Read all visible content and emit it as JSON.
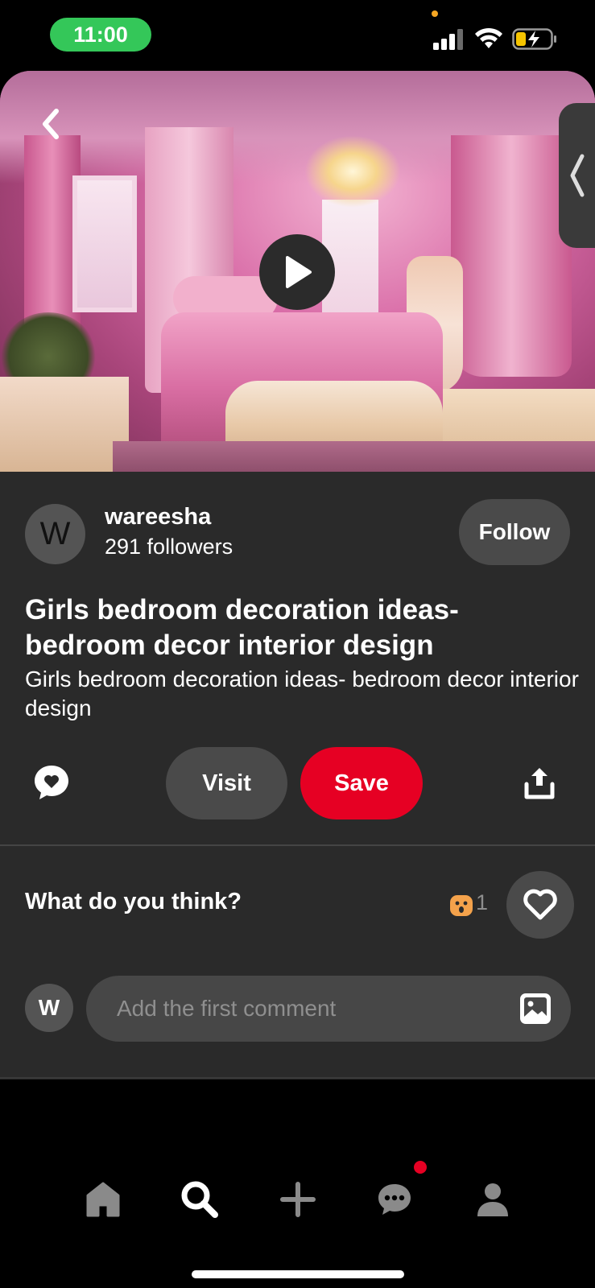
{
  "status_bar": {
    "time": "11:00",
    "signal_icon": "cellular-signal-icon",
    "wifi_icon": "wifi-icon",
    "battery_icon": "battery-charging-icon",
    "time_pill_color": "#34c759"
  },
  "hero": {
    "back_icon": "chevron-left-icon",
    "play_icon": "play-icon",
    "side_tab_icon": "chevron-left-icon"
  },
  "pin": {
    "author_initial": "W",
    "author_name": "wareesha",
    "followers": "291 followers",
    "follow_label": "Follow",
    "title": "Girls bedroom decoration ideas- bedroom decor interior design",
    "description": "Girls bedroom decoration ideas- bedroom decor interior design"
  },
  "actions": {
    "comment_icon": "comment-heart-icon",
    "visit_label": "Visit",
    "save_label": "Save",
    "share_icon": "share-icon",
    "save_color": "#e60023"
  },
  "feedback": {
    "prompt": "What do you think?",
    "reaction_icon": "wow-emoji-icon",
    "reaction_count": "1",
    "heart_icon": "heart-icon"
  },
  "comment": {
    "user_initial": "W",
    "placeholder": "Add the first comment",
    "image_icon": "image-icon"
  },
  "bottom_nav": {
    "items": [
      {
        "name": "home",
        "icon": "home-icon"
      },
      {
        "name": "search",
        "icon": "search-icon"
      },
      {
        "name": "create",
        "icon": "plus-icon"
      },
      {
        "name": "messages",
        "icon": "chat-icon"
      },
      {
        "name": "profile",
        "icon": "profile-icon"
      }
    ],
    "notification_color": "#e60023"
  }
}
